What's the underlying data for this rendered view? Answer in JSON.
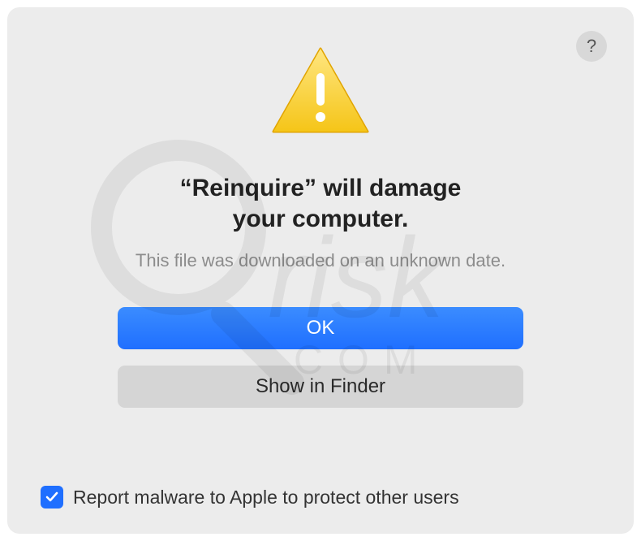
{
  "dialog": {
    "title_line1": "“Reinquire” will damage",
    "title_line2": "your computer.",
    "subtitle": "This file was downloaded on an unknown date.",
    "primary_button": "OK",
    "secondary_button": "Show in Finder",
    "checkbox_label": "Report malware to Apple to protect other users",
    "checkbox_checked": true,
    "help_label": "?"
  },
  "icons": {
    "warning": "warning-icon",
    "help": "help-icon",
    "check": "check-icon"
  }
}
